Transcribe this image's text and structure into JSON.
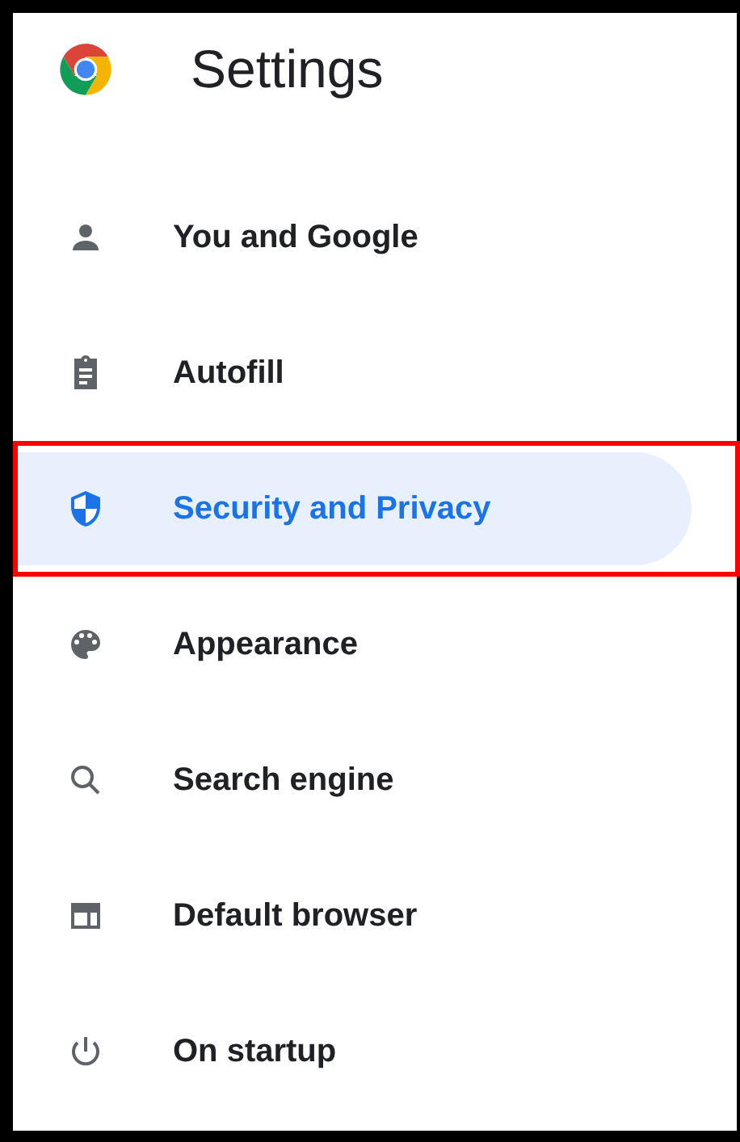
{
  "header": {
    "title": "Settings"
  },
  "menu": [
    {
      "label": "You and Google",
      "selected": false,
      "highlighted": false
    },
    {
      "label": "Autofill",
      "selected": false,
      "highlighted": false
    },
    {
      "label": "Security and Privacy",
      "selected": true,
      "highlighted": true
    },
    {
      "label": "Appearance",
      "selected": false,
      "highlighted": false
    },
    {
      "label": "Search engine",
      "selected": false,
      "highlighted": false
    },
    {
      "label": "Default browser",
      "selected": false,
      "highlighted": false
    },
    {
      "label": "On startup",
      "selected": false,
      "highlighted": false
    }
  ]
}
